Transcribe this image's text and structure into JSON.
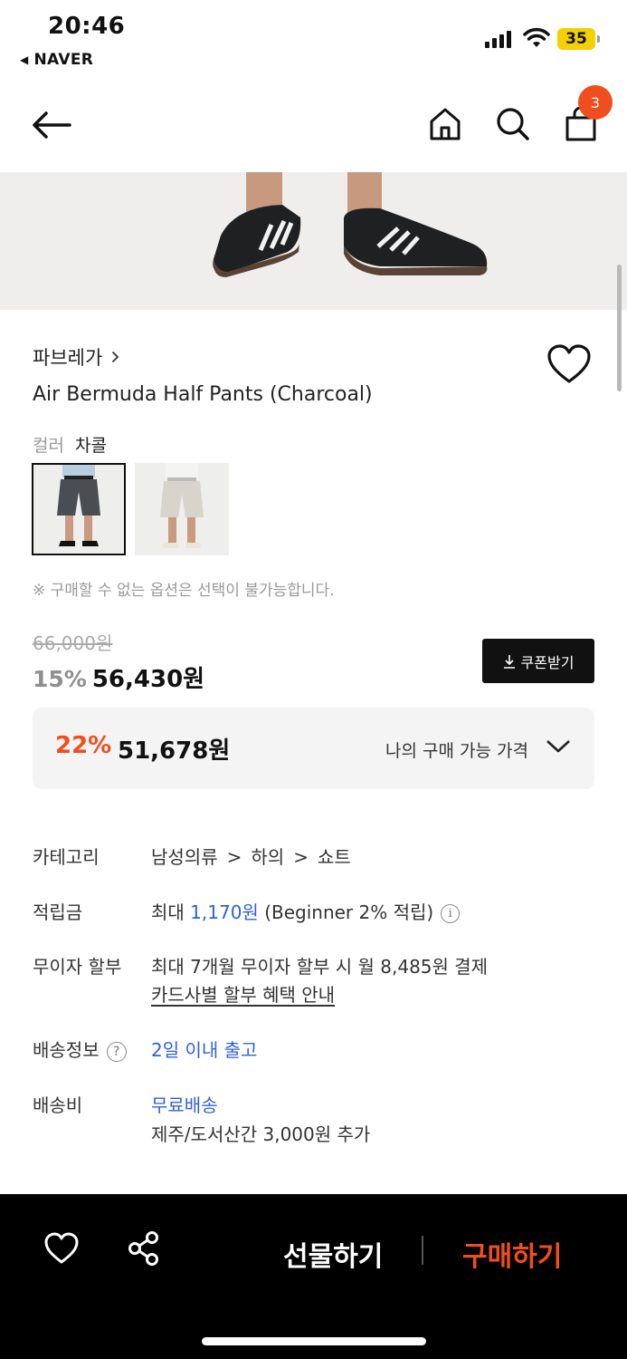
{
  "status_bar": {
    "time": "20:46",
    "back_app": "NAVER",
    "battery": "35"
  },
  "nav": {
    "cart_count": "3"
  },
  "product": {
    "brand": "파브레가",
    "name": "Air Bermuda Half Pants (Charcoal)",
    "color_label": "컬러",
    "color_value": "차콜",
    "option_notice": "※ 구매할 수 없는 옵션은 선택이 불가능합니다."
  },
  "price": {
    "original": "66,000원",
    "discount_pct": "15%",
    "sale_price": "56,430원",
    "coupon_button": "쿠폰받기",
    "my_discount_pct": "22%",
    "my_price": "51,678원",
    "my_price_label": "나의 구매 가능 가격"
  },
  "info": {
    "category_label": "카테고리",
    "category_path": [
      "남성의류",
      "하의",
      "쇼트"
    ],
    "points_label": "적립금",
    "points_prefix": "최대",
    "points_amount": "1,170원",
    "points_suffix": "(Beginner 2% 적립)",
    "installment_label": "무이자 할부",
    "installment_text": "최대 7개월 무이자 할부 시 월 8,485원 결제",
    "installment_link": "카드사별 할부 혜택 안내",
    "delivery_label": "배송정보",
    "delivery_value": "2일 이내 출고",
    "shipping_fee_label": "배송비",
    "shipping_fee_value": "무료배송",
    "shipping_fee_note": "제주/도서산간 3,000원 추가"
  },
  "bottom_bar": {
    "gift_label": "선물하기",
    "buy_label": "구매하기"
  },
  "colors": {
    "accent": "#f04e1c",
    "link_blue": "#2f62dc",
    "battery": "#f5d000"
  },
  "icons": [
    "back-arrow-icon",
    "home-icon",
    "search-icon",
    "shopping-bag-icon",
    "heart-icon",
    "download-icon",
    "chevron-down-icon",
    "share-icon",
    "help-icon",
    "info-icon"
  ]
}
